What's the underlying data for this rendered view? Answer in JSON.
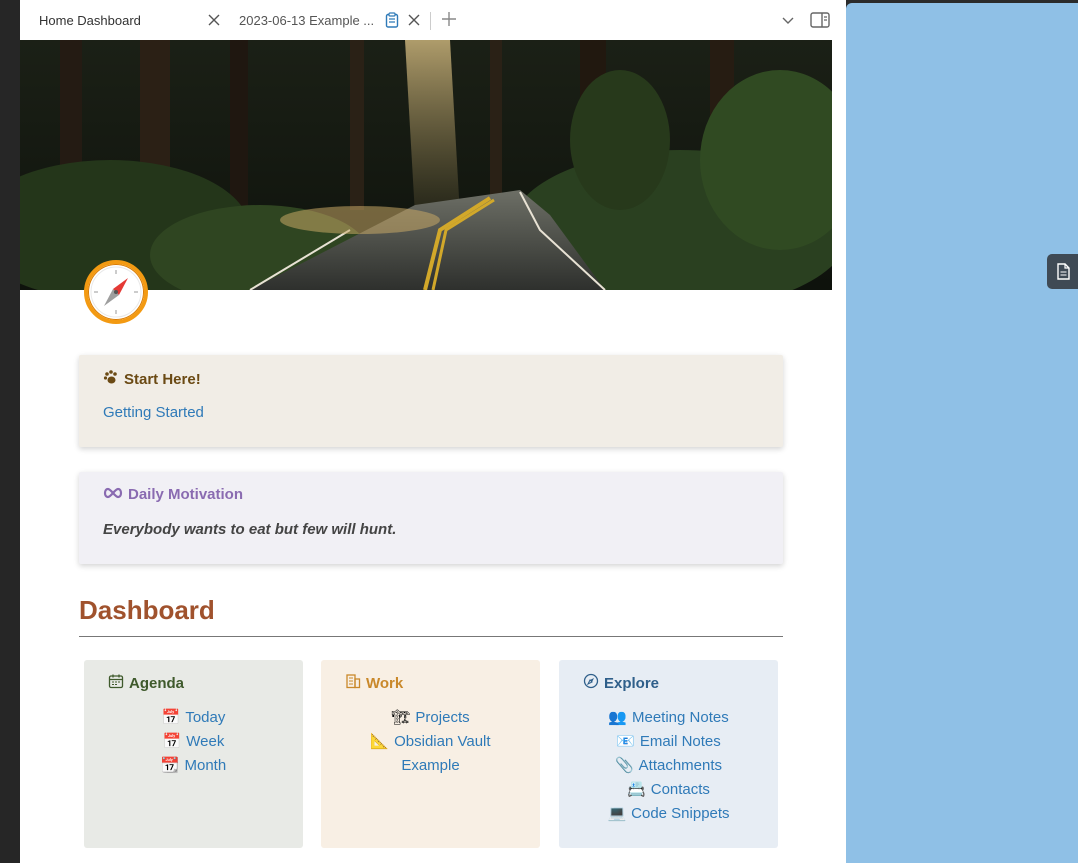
{
  "tabs": [
    {
      "label": "Home Dashboard"
    },
    {
      "label": "2023-06-13 Example ..."
    }
  ],
  "callouts": {
    "start": {
      "title": "Start Here!",
      "link": "Getting Started"
    },
    "motivation": {
      "title": "Daily Motivation",
      "quote": "Everybody wants to eat but few will hunt."
    }
  },
  "dashboard": {
    "title": "Dashboard",
    "cards": {
      "agenda": {
        "title": "Agenda",
        "items": [
          {
            "emoji": "📅",
            "label": "Today"
          },
          {
            "emoji": "📅",
            "label": "Week"
          },
          {
            "emoji": "📆",
            "label": "Month"
          }
        ]
      },
      "work": {
        "title": "Work",
        "items": [
          {
            "emoji": "🏗",
            "label": "Projects"
          },
          {
            "emoji": "📐",
            "label": "Obsidian Vault"
          },
          {
            "emoji": "",
            "label": "Example"
          }
        ]
      },
      "explore": {
        "title": "Explore",
        "items": [
          {
            "emoji": "👥",
            "label": "Meeting Notes"
          },
          {
            "emoji": "📧",
            "label": "Email Notes"
          },
          {
            "emoji": "📎",
            "label": "Attachments"
          },
          {
            "emoji": "📇",
            "label": "Contacts"
          },
          {
            "emoji": "💻",
            "label": "Code Snippets"
          }
        ]
      }
    }
  },
  "colors": {
    "accent_orange": "#f39a12",
    "dashboard_heading": "#a0522d",
    "link": "#2f7ab8",
    "side_pane": "#8fc0e6"
  },
  "icons": {
    "start_here": "paw-icon",
    "motivation": "infinity-icon",
    "agenda": "calendar-icon",
    "work": "building-icon",
    "explore": "compass-icon",
    "banner_logo": "safari-compass-icon"
  }
}
